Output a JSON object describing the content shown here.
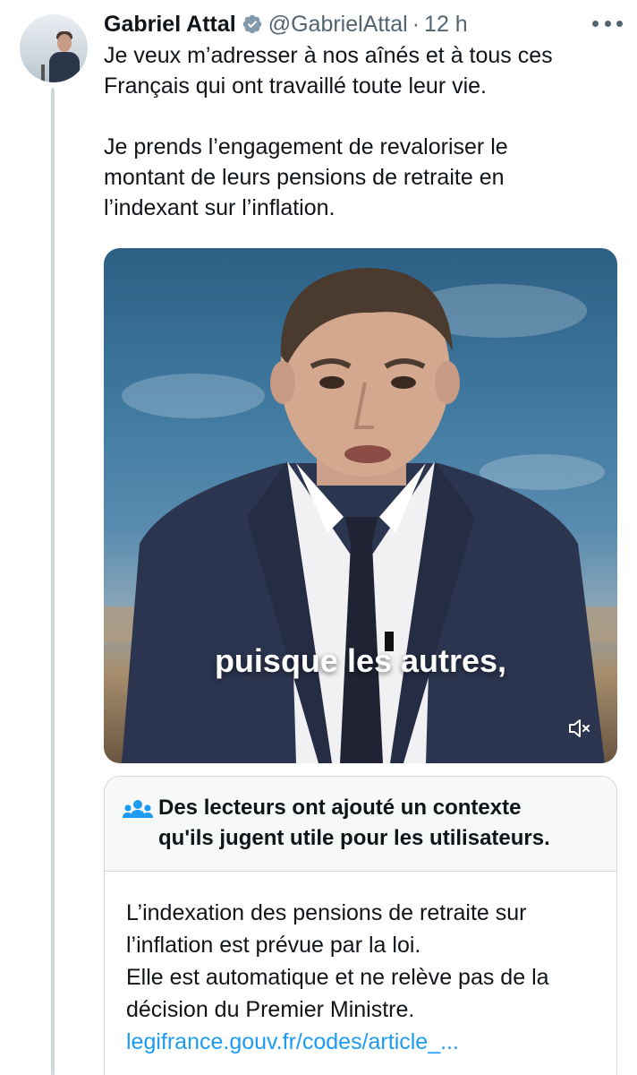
{
  "tweet": {
    "author_name": "Gabriel Attal",
    "handle": "@GabrielAttal",
    "separator": "·",
    "time": "12 h",
    "lines_para1": [
      "Je veux m’adresser à nos aînés et à tous ces",
      "Français qui ont travaillé toute leur vie."
    ],
    "lines_para2": [
      "Je prends l’engagement de revaloriser le",
      "montant de leurs pensions de retraite en",
      "l’indexant sur l’inflation."
    ]
  },
  "media": {
    "caption": "puisque les autres,",
    "mute_icon": "speaker-muted-icon"
  },
  "community_note": {
    "title_line1": "Des lecteurs ont ajouté un contexte",
    "title_line2": "qu'ils jugent utile pour les utilisateurs.",
    "body_lines": [
      "L’indexation des pensions de retraite sur",
      "l’inflation est prévue par la loi.",
      "Elle est automatique et ne relève pas de la",
      "décision du Premier Ministre."
    ],
    "link": "legifrance.gouv.fr/codes/article_..."
  },
  "colors": {
    "text_primary": "#0f1419",
    "text_secondary": "#536471",
    "link": "#1d9bf0",
    "border": "#cfd9de",
    "note_header_bg": "#f7f9f9"
  },
  "icons": {
    "verified": "verified-badge-icon",
    "more": "more-options-icon",
    "people": "people-icon"
  }
}
